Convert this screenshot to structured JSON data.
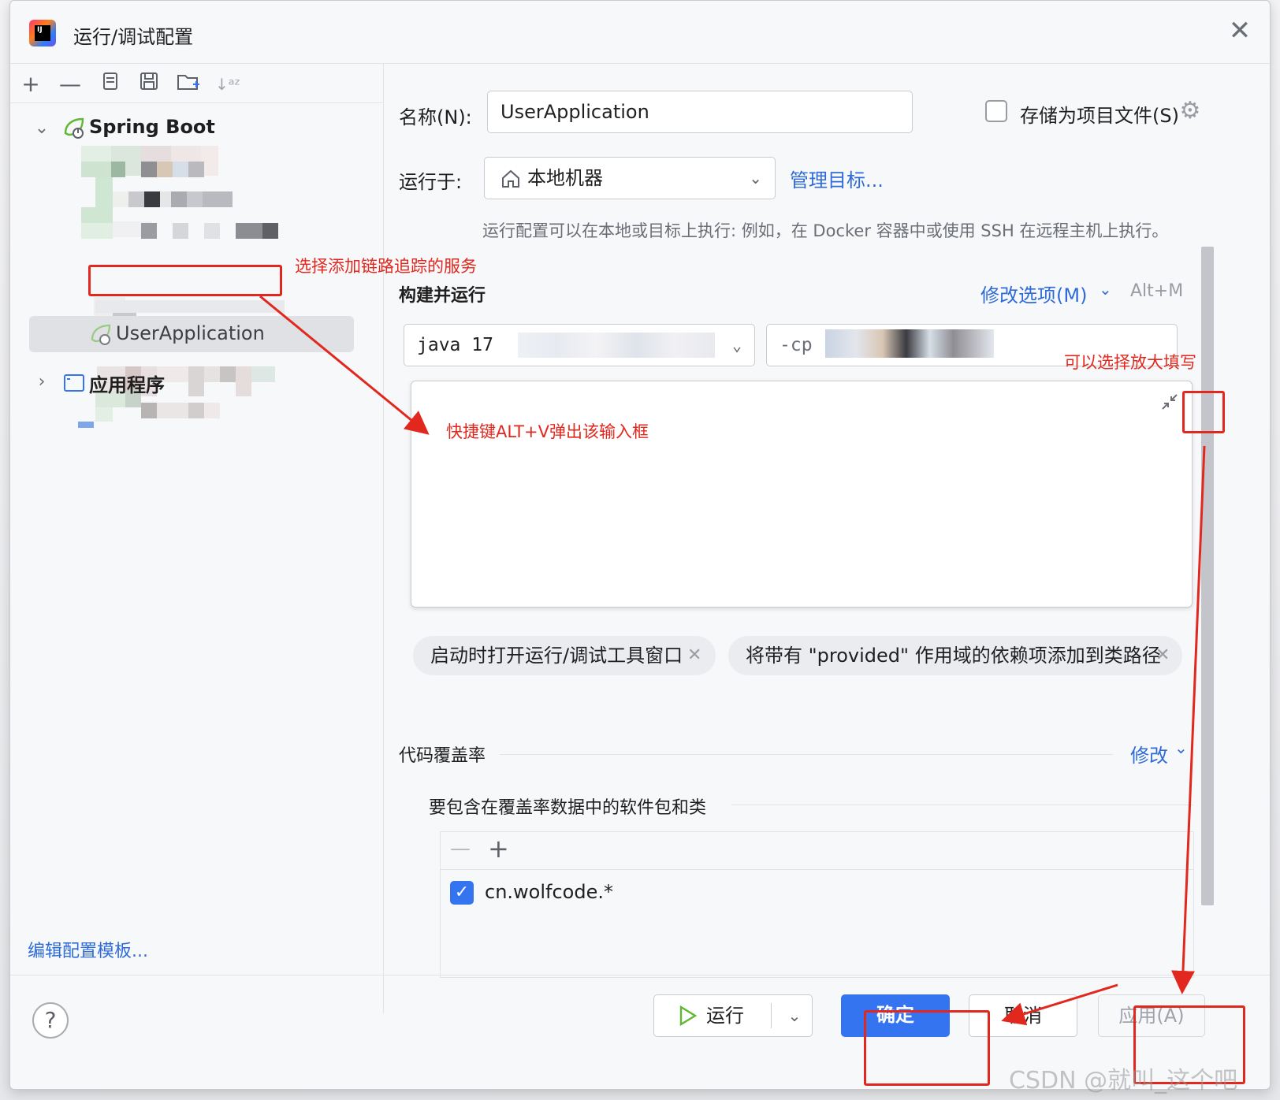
{
  "window": {
    "title": "运行/调试配置",
    "close_label": "✕"
  },
  "toolbar": {
    "icons": [
      "add-icon",
      "remove-icon",
      "copy-icon",
      "save-icon",
      "new-folder-icon",
      "sort-icon"
    ]
  },
  "tree": {
    "spring_boot_label": "Spring Boot",
    "user_app_label": "UserApplication",
    "application_label": "应用程序"
  },
  "left_footer": {
    "edit_templates": "编辑配置模板..."
  },
  "form": {
    "name_label": "名称(N):",
    "name_value": "UserApplication",
    "store_as_project_file": "存储为项目文件(S)",
    "run_on_label": "运行于:",
    "run_on_value": "本地机器",
    "manage_targets": "管理目标...",
    "run_on_hint": "运行配置可以在本地或目标上执行: 例如，在 Docker 容器中或使用 SSH 在远程主机上执行。",
    "build_run_title": "构建并运行",
    "modify_options": "修改选项(M)",
    "modify_shortcut": "Alt+M",
    "jdk_value": "java 17",
    "cp_value": "-cp",
    "vm_options_value": ""
  },
  "chips": [
    {
      "label": "启动时打开运行/调试工具窗口"
    },
    {
      "label": "将带有 \"provided\" 作用域的依赖项添加到类路径"
    }
  ],
  "coverage": {
    "title": "代码覆盖率",
    "modify": "修改",
    "include_label": "要包含在覆盖率数据中的软件包和类",
    "rows": [
      {
        "checked": true,
        "pattern": "cn.wolfcode.*"
      }
    ]
  },
  "buttons": {
    "help": "?",
    "run": "运行",
    "ok": "确定",
    "cancel": "取消",
    "apply": "应用(A)"
  },
  "annotations": {
    "select_service": "选择添加链路追踪的服务",
    "shortcut_hint": "快捷键ALT+V弹出该输入框",
    "expand_hint": "可以选择放大填写"
  },
  "watermark": "CSDN @就叫_这个吧",
  "colors": {
    "accent": "#3574f0",
    "link": "#2f6bd8",
    "annotation": "#e2281e",
    "spring_green": "#5fb832"
  }
}
